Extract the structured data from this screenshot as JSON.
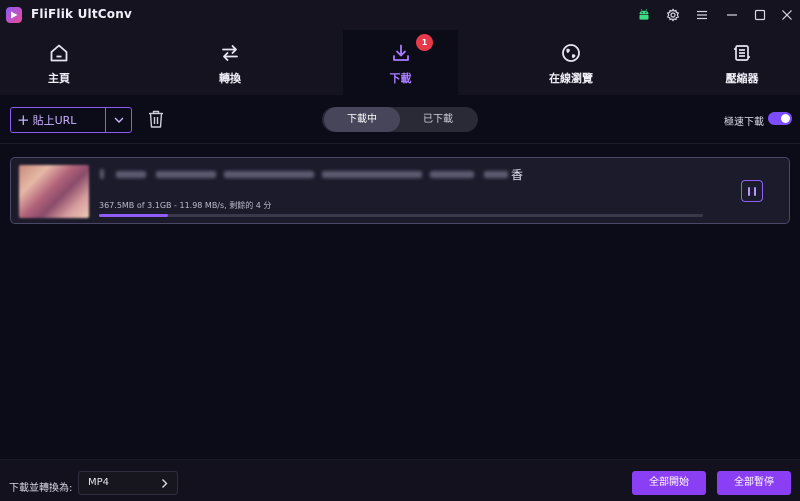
{
  "app": {
    "title": "FliFlik UltConv"
  },
  "titlebar": {
    "icons": [
      "android-icon",
      "settings-gear-icon",
      "menu-icon",
      "minimize-icon",
      "maximize-icon",
      "close-icon"
    ]
  },
  "nav": {
    "items": [
      {
        "label": "主頁",
        "icon": "home-icon"
      },
      {
        "label": "轉換",
        "icon": "convert-arrows-icon"
      },
      {
        "label": "下載",
        "icon": "download-icon",
        "active": true,
        "badge": "1"
      },
      {
        "label": "在線瀏覽",
        "icon": "globe-icon"
      },
      {
        "label": "壓縮器",
        "icon": "compress-icon"
      }
    ]
  },
  "toolbar": {
    "paste_label": "貼上URL",
    "segments": [
      {
        "label": "下載中",
        "active": true
      },
      {
        "label": "已下載",
        "active": false
      }
    ],
    "turbo_label": "極速下載",
    "turbo_on": true
  },
  "download": {
    "title_suffix": "香",
    "progress_text": "367.5MB of 3.1GB - 11.98 MB/s, 剩餘的 4 分",
    "progress_fraction": 0.115
  },
  "bottom": {
    "convert_label": "下載並轉換為:",
    "format_value": "MP4",
    "start_all_label": "全部開始",
    "pause_all_label": "全部暫停"
  },
  "colors": {
    "accent": "#8b3ff4",
    "accent_light": "#a97dff",
    "background": "#0c0b18",
    "badge": "#e53a4a"
  }
}
